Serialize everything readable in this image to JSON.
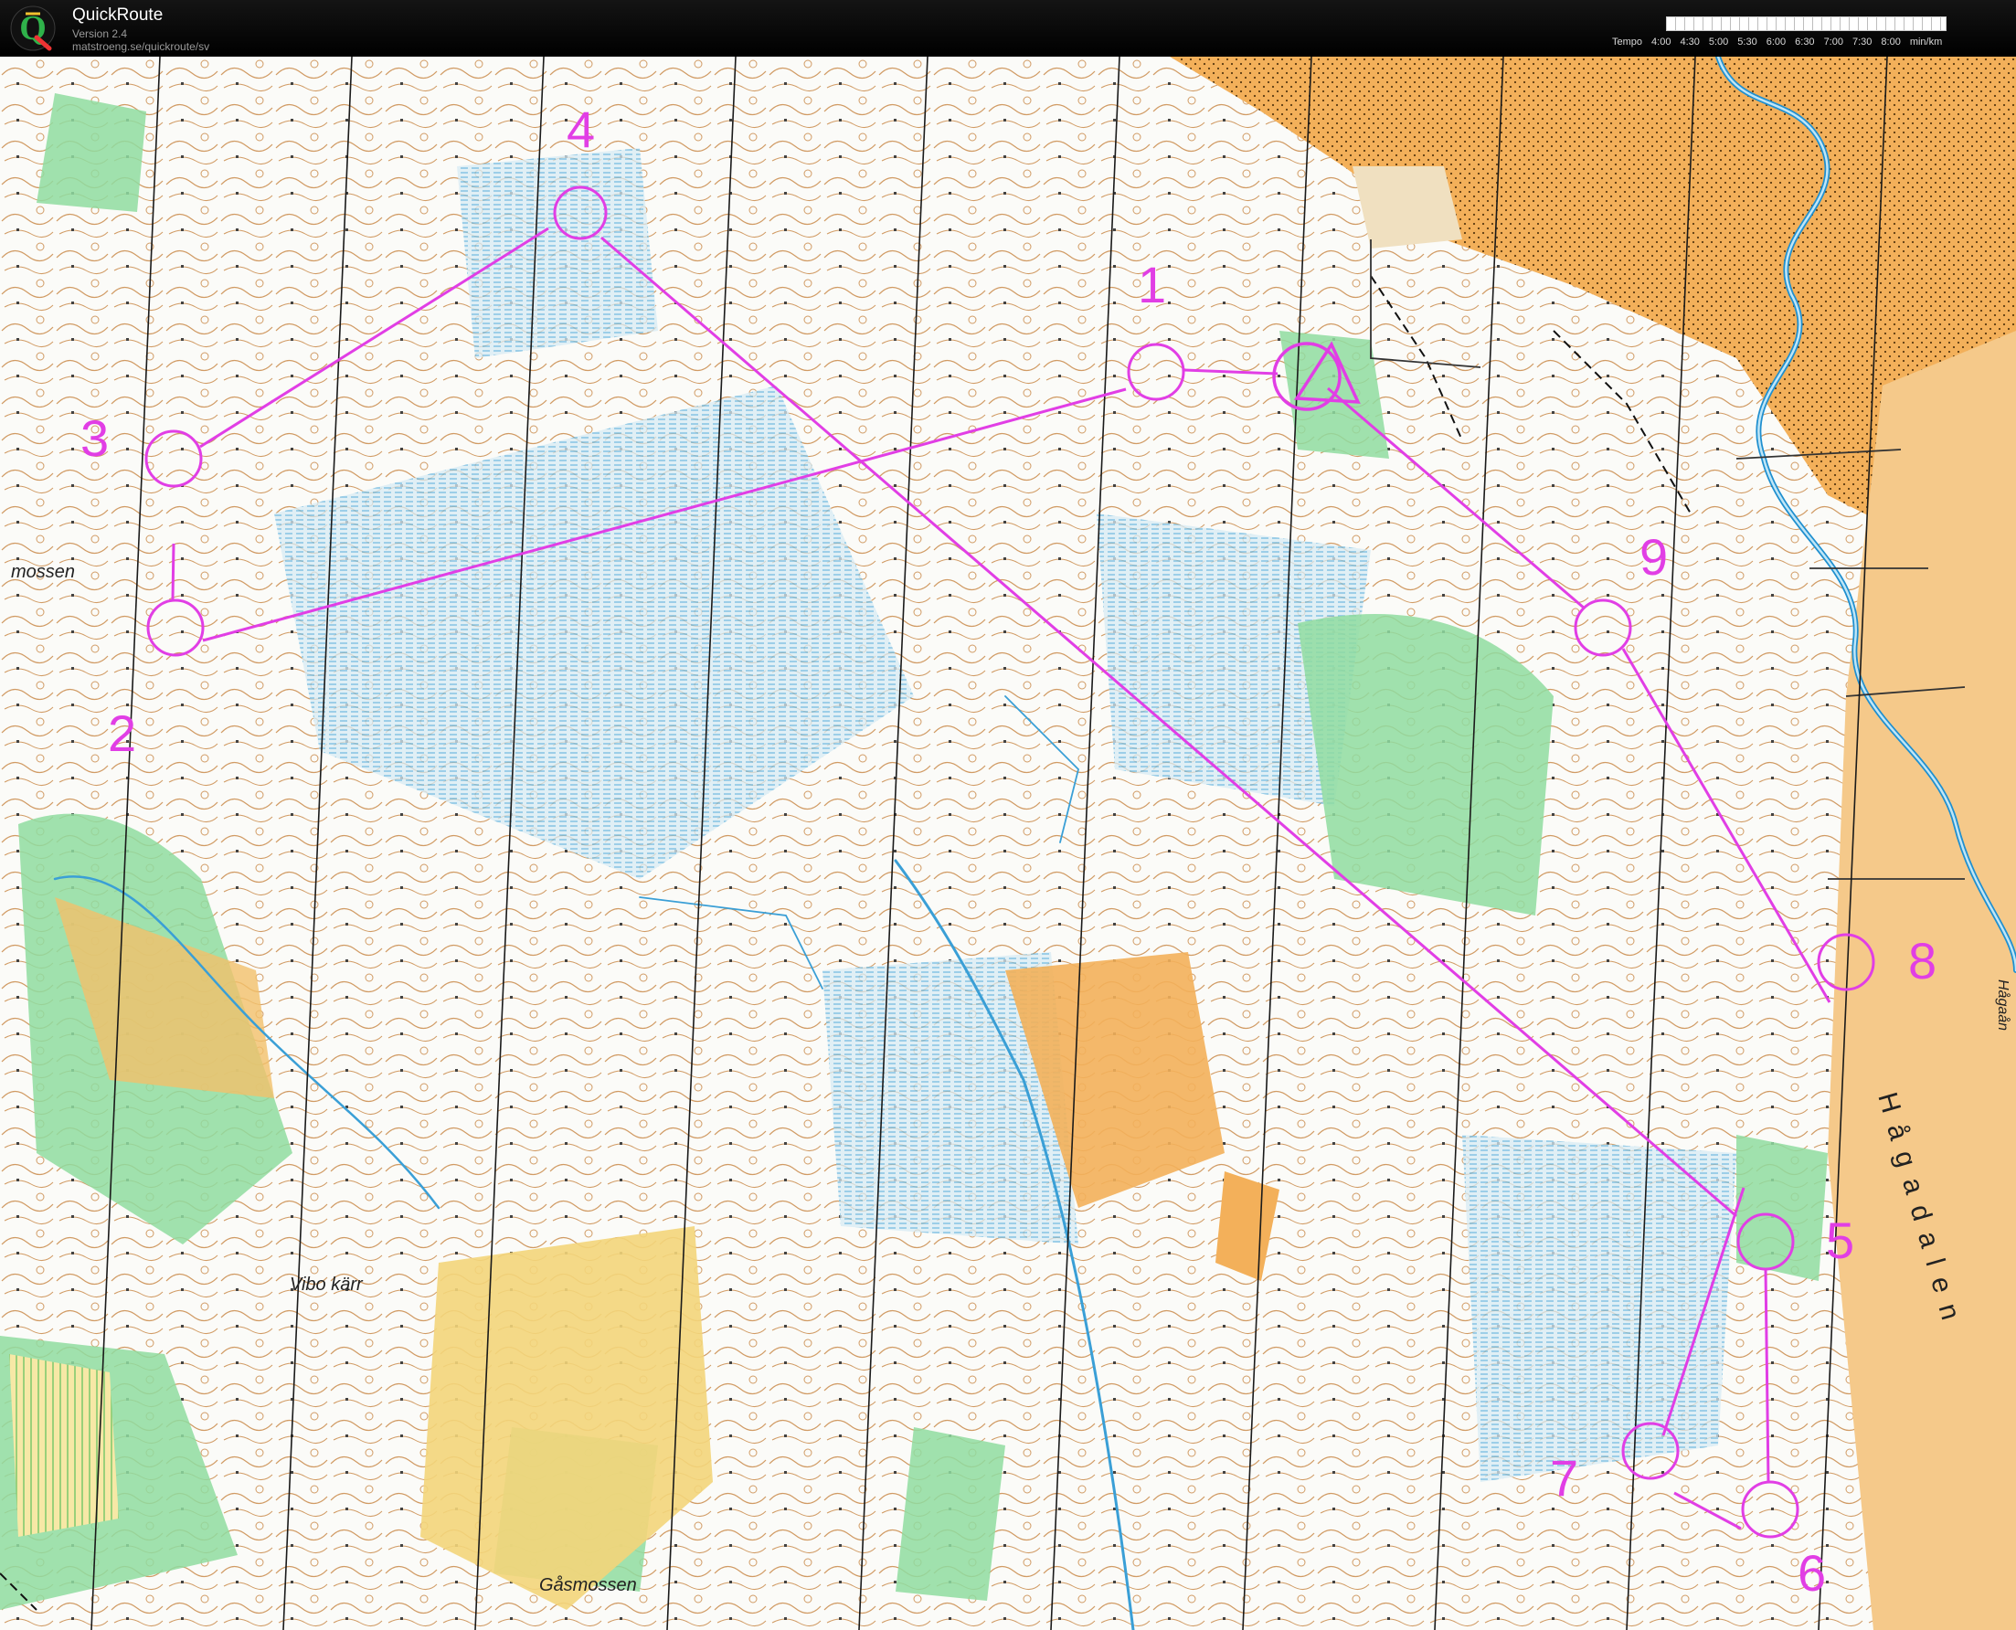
{
  "header": {
    "app_name": "QuickRoute",
    "version": "Version 2.4",
    "url": "matstroeng.se/quickroute/sv",
    "tempo_prefix": "Tempo",
    "tempo_ticks": [
      "4:00",
      "4:30",
      "5:00",
      "5:30",
      "6:00",
      "6:30",
      "7:00",
      "7:30",
      "8:00"
    ],
    "tempo_unit": "min/km"
  },
  "map": {
    "course_color": "#e13ee5",
    "place_names": {
      "mossen": "mossen",
      "vibo_karr": "Vibo kärr",
      "gasmossen": "Gåsmossen",
      "hagadalen": "Hågadalen",
      "hagaan": "Hågaån"
    },
    "controls": [
      {
        "label": "1"
      },
      {
        "label": "2"
      },
      {
        "label": "3"
      },
      {
        "label": "4"
      },
      {
        "label": "5"
      },
      {
        "label": "6"
      },
      {
        "label": "7"
      },
      {
        "label": "8"
      },
      {
        "label": "9"
      }
    ]
  }
}
